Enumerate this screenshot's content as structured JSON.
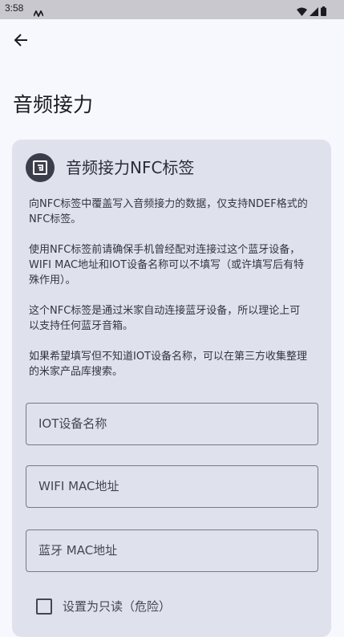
{
  "status_bar": {
    "time": "3:58",
    "icons": [
      "activity-icon",
      "wifi-icon",
      "signal-icon",
      "battery-icon"
    ]
  },
  "header": {
    "back_icon": "arrow-left-icon"
  },
  "page": {
    "title": "音频接力"
  },
  "card": {
    "icon": "nfc-icon",
    "title": "音频接力NFC标签",
    "paragraphs": [
      "向NFC标签中覆盖写入音频接力的数据，仅支持NDEF格式的NFC标签。",
      "使用NFC标签前请确保手机曾经配对连接过这个蓝牙设备，WIFI MAC地址和IOT设备名称可以不填写（或许填写后有特殊作用）。",
      "这个NFC标签是通过米家自动连接蓝牙设备，所以理论上可以支持任何蓝牙音箱。",
      "如果希望填写但不知道IOT设备名称，可以在第三方收集整理的米家产品库搜索。"
    ],
    "fields": {
      "iot_name": "IOT设备名称",
      "wifi_mac": "WIFI MAC地址",
      "bt_mac": "蓝牙 MAC地址"
    },
    "readonly_label": "设置为只读（危险）"
  },
  "colors": {
    "background": "#f7f8fe",
    "card": "#dfe1ec",
    "icon_circle": "#3b3e4a",
    "status_bar": "#c8c8ce"
  }
}
